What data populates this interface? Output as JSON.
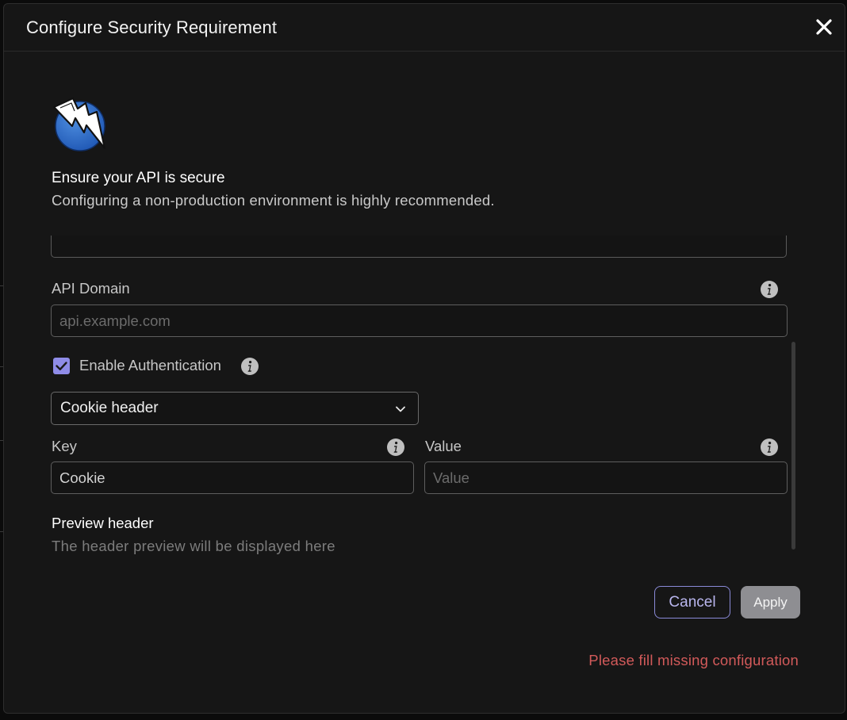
{
  "dialog": {
    "title": "Configure Security Requirement",
    "close_icon": "close-icon"
  },
  "intro": {
    "logo_icon": "lightning-bolt-logo-icon",
    "heading": "Ensure your API is secure",
    "subheading": "Configuring a non-production environment is highly recommended."
  },
  "form": {
    "api_domain": {
      "label": "API Domain",
      "value": "",
      "placeholder": "api.example.com",
      "info_icon": "info-icon"
    },
    "enable_authentication": {
      "label": "Enable Authentication",
      "checked": true,
      "info_icon": "info-icon"
    },
    "auth_type": {
      "selected": "Cookie header",
      "chevron_icon": "chevron-down-icon"
    },
    "key": {
      "label": "Key",
      "value": "Cookie",
      "placeholder": "",
      "info_icon": "info-icon"
    },
    "value": {
      "label": "Value",
      "value": "",
      "placeholder": "Value",
      "info_icon": "info-icon"
    },
    "preview": {
      "title": "Preview header",
      "text": "The header preview will be displayed here"
    }
  },
  "actions": {
    "cancel_label": "Cancel",
    "apply_label": "Apply",
    "error_message": "Please fill missing configuration"
  },
  "colors": {
    "accent": "#8f8ce8",
    "error": "#d25a5a",
    "background": "#161616"
  }
}
